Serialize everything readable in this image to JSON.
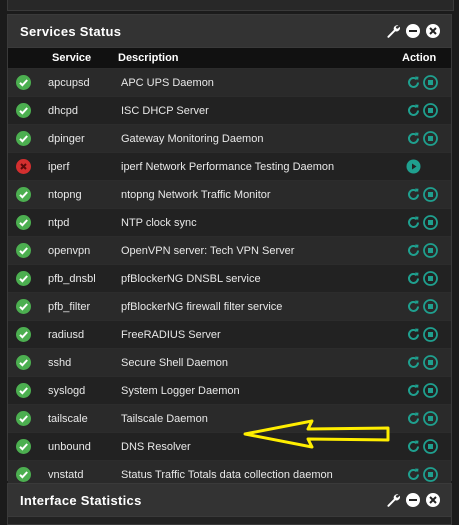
{
  "services_panel": {
    "title": "Services Status",
    "columns": {
      "service": "Service",
      "description": "Description",
      "action": "Action"
    },
    "rows": [
      {
        "service": "apcupsd",
        "description": "APC UPS Daemon",
        "status": "running"
      },
      {
        "service": "dhcpd",
        "description": "ISC DHCP Server",
        "status": "running"
      },
      {
        "service": "dpinger",
        "description": "Gateway Monitoring Daemon",
        "status": "running"
      },
      {
        "service": "iperf",
        "description": "iperf Network Performance Testing Daemon",
        "status": "stopped"
      },
      {
        "service": "ntopng",
        "description": "ntopng Network Traffic Monitor",
        "status": "running"
      },
      {
        "service": "ntpd",
        "description": "NTP clock sync",
        "status": "running"
      },
      {
        "service": "openvpn",
        "description": "OpenVPN server: Tech VPN Server",
        "status": "running"
      },
      {
        "service": "pfb_dnsbl",
        "description": "pfBlockerNG DNSBL service",
        "status": "running"
      },
      {
        "service": "pfb_filter",
        "description": "pfBlockerNG firewall filter service",
        "status": "running"
      },
      {
        "service": "radiusd",
        "description": "FreeRADIUS Server",
        "status": "running"
      },
      {
        "service": "sshd",
        "description": "Secure Shell Daemon",
        "status": "running"
      },
      {
        "service": "syslogd",
        "description": "System Logger Daemon",
        "status": "running"
      },
      {
        "service": "tailscale",
        "description": "Tailscale Daemon",
        "status": "running"
      },
      {
        "service": "unbound",
        "description": "DNS Resolver",
        "status": "running"
      },
      {
        "service": "vnstatd",
        "description": "Status Traffic Totals data collection daemon",
        "status": "running"
      }
    ]
  },
  "interface_panel": {
    "title": "Interface Statistics"
  },
  "colors": {
    "running": "#4caf50",
    "stopped": "#d32f2f",
    "action": "#1fa08f",
    "arrow": "#ffee00"
  },
  "icons": {
    "running": "check-circle-icon",
    "stopped": "x-circle-icon",
    "restart": "restart-icon",
    "stop": "stop-icon",
    "start": "play-icon",
    "settings": "wrench-icon",
    "minimize": "minus-icon",
    "close": "close-icon"
  }
}
